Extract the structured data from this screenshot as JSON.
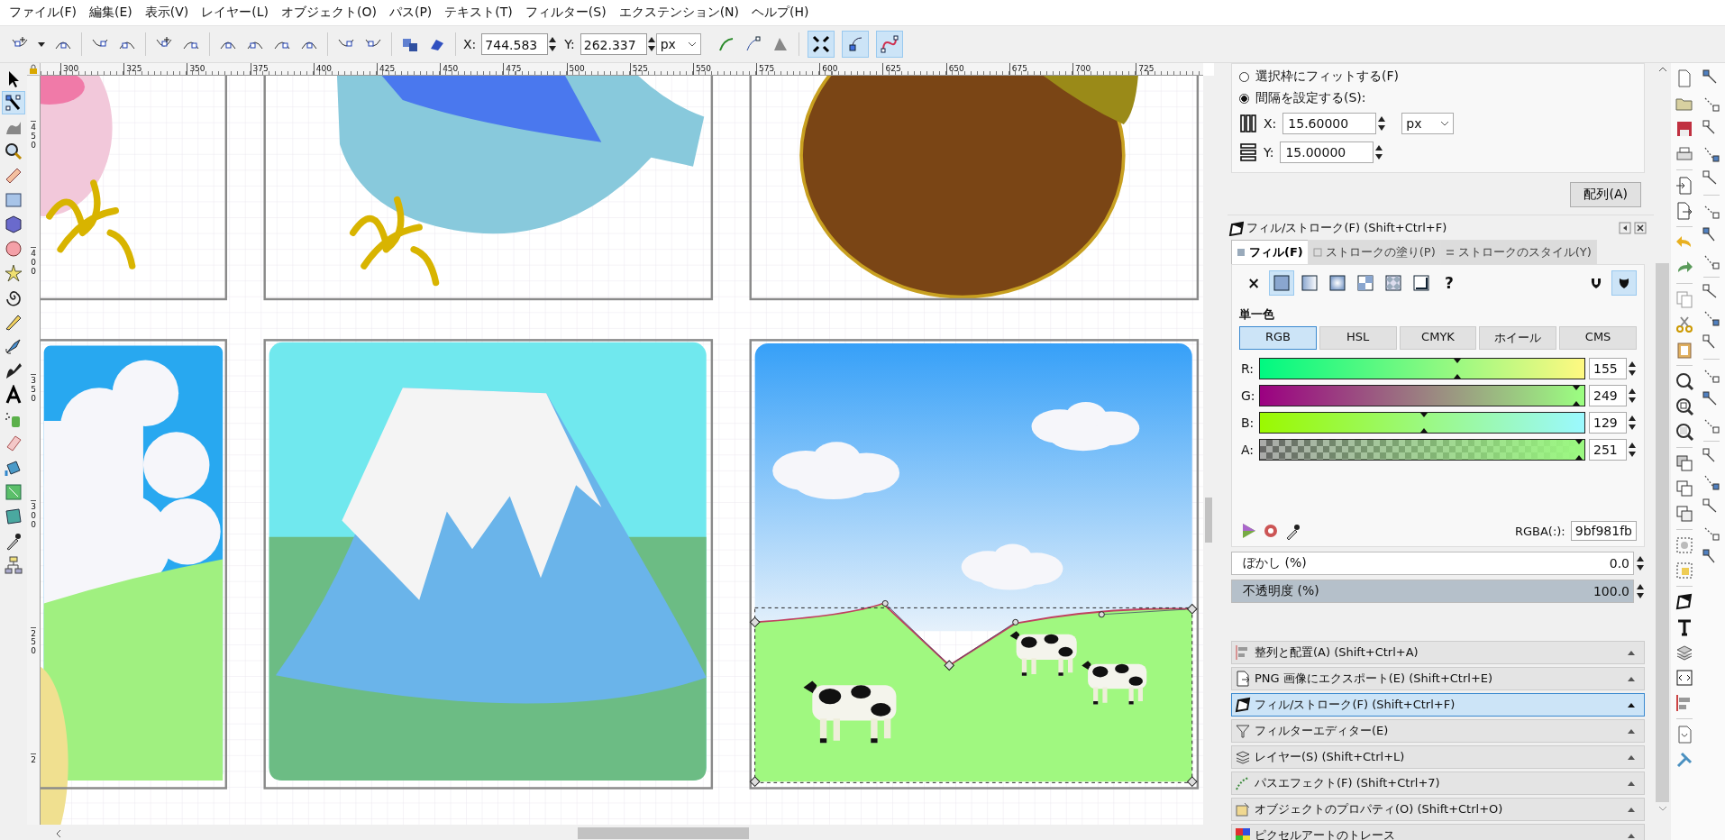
{
  "menu": [
    "ファイル(F)",
    "編集(E)",
    "表示(V)",
    "レイヤー(L)",
    "オブジェクト(O)",
    "パス(P)",
    "テキスト(T)",
    "フィルター(S)",
    "エクステンション(N)",
    "ヘルプ(H)"
  ],
  "toolbar": {
    "x_label": "X:",
    "x_value": "744.583",
    "y_label": "Y:",
    "y_value": "262.337",
    "unit": "px",
    "toggles": [
      {
        "on": true
      },
      {
        "on": true
      },
      {
        "on": true
      }
    ]
  },
  "toolbox": {
    "tools": [
      {
        "selected": false
      },
      {
        "selected": true
      },
      {
        "selected": false
      },
      {
        "selected": false
      },
      {
        "selected": false
      },
      {
        "selected": false
      },
      {
        "selected": false
      },
      {
        "selected": false
      },
      {
        "selected": false
      },
      {
        "selected": false
      },
      {
        "selected": false
      },
      {
        "selected": false
      },
      {
        "selected": false
      },
      {
        "selected": false
      },
      {
        "selected": false
      },
      {
        "selected": false
      },
      {
        "selected": false
      },
      {
        "selected": false
      },
      {
        "selected": false
      },
      {
        "selected": false
      },
      {
        "selected": false
      }
    ]
  },
  "rulers": {
    "horizontal": [
      "300",
      "325",
      "350",
      "375",
      "400",
      "425",
      "450",
      "475",
      "500",
      "525",
      "550",
      "575",
      "600",
      "625",
      "650",
      "675",
      "700",
      "725"
    ],
    "vertical": [
      "450",
      "400",
      "350",
      "300",
      "250",
      "2"
    ]
  },
  "dock": {
    "align": {
      "options": [
        {
          "label": "選択枠にフィットする(F)",
          "selected": false
        },
        {
          "label": "間隔を設定する(S):",
          "selected": true
        }
      ],
      "x_label": "X:",
      "x_value": "15.60000",
      "unit": "px",
      "y_label": "Y:",
      "y_value": "15.00000",
      "button": "配列(A)"
    },
    "fill_stroke": {
      "title": "フィル/ストローク(F) (Shift+Ctrl+F)",
      "tabs": [
        {
          "label": "フィル(F)",
          "selected": true
        },
        {
          "label": "ストロークの塗り(P)",
          "selected": false
        },
        {
          "label": "ストロークのスタイル(Y)",
          "selected": false
        }
      ],
      "paint_types": [
        {
          "kind": "none",
          "label": "×",
          "selected": false
        },
        {
          "kind": "flat",
          "selected": true
        },
        {
          "kind": "linear",
          "selected": false
        },
        {
          "kind": "radial",
          "selected": false
        },
        {
          "kind": "mesh",
          "selected": false
        },
        {
          "kind": "pattern",
          "selected": false
        },
        {
          "kind": "swatch",
          "selected": false
        },
        {
          "kind": "unset",
          "label": "?",
          "selected": false
        }
      ],
      "fill_rules": [
        {
          "selected": false
        },
        {
          "selected": true
        }
      ],
      "section": "単一色",
      "modes": [
        {
          "label": "RGB",
          "selected": true
        },
        {
          "label": "HSL",
          "selected": false
        },
        {
          "label": "CMYK",
          "selected": false
        },
        {
          "label": "ホイール",
          "selected": false
        },
        {
          "label": "CMS",
          "selected": false
        }
      ],
      "channels": [
        {
          "kind": "r",
          "label": "R:",
          "value": "155",
          "level": 0.608
        },
        {
          "kind": "g",
          "label": "G:",
          "value": "249",
          "level": 0.976
        },
        {
          "kind": "b",
          "label": "B:",
          "value": "129",
          "level": 0.506
        },
        {
          "kind": "a",
          "label": "A:",
          "value": "251",
          "level": 0.984
        }
      ],
      "rgba_label": "RGBA(:):",
      "rgba_value": "9bf981fb",
      "blur": {
        "label": "ぼかし (%)",
        "value": "0.0",
        "level": 0
      },
      "opacity": {
        "label": "不透明度 (%)",
        "value": "100.0",
        "level": 1
      }
    },
    "panels": [
      {
        "kind": "align",
        "title": "整列と配置(A) (Shift+Ctrl+A)",
        "selected": false
      },
      {
        "kind": "export",
        "title": "PNG 画像にエクスポート(E) (Shift+Ctrl+E)",
        "selected": false
      },
      {
        "kind": "fill",
        "title": "フィル/ストローク(F) (Shift+Ctrl+F)",
        "selected": true
      },
      {
        "kind": "filter",
        "title": "フィルターエディター(E)",
        "selected": false
      },
      {
        "kind": "layers",
        "title": "レイヤー(S) (Shift+Ctrl+L)",
        "selected": false
      },
      {
        "kind": "effect",
        "title": "パスエフェクト(F) (Shift+Ctrl+7)",
        "selected": false
      },
      {
        "kind": "props",
        "title": "オブジェクトのプロパティ(O) (Shift+Ctrl+O)",
        "selected": false
      },
      {
        "kind": "trace",
        "title": "ピクセルアートのトレース",
        "selected": false
      }
    ]
  }
}
